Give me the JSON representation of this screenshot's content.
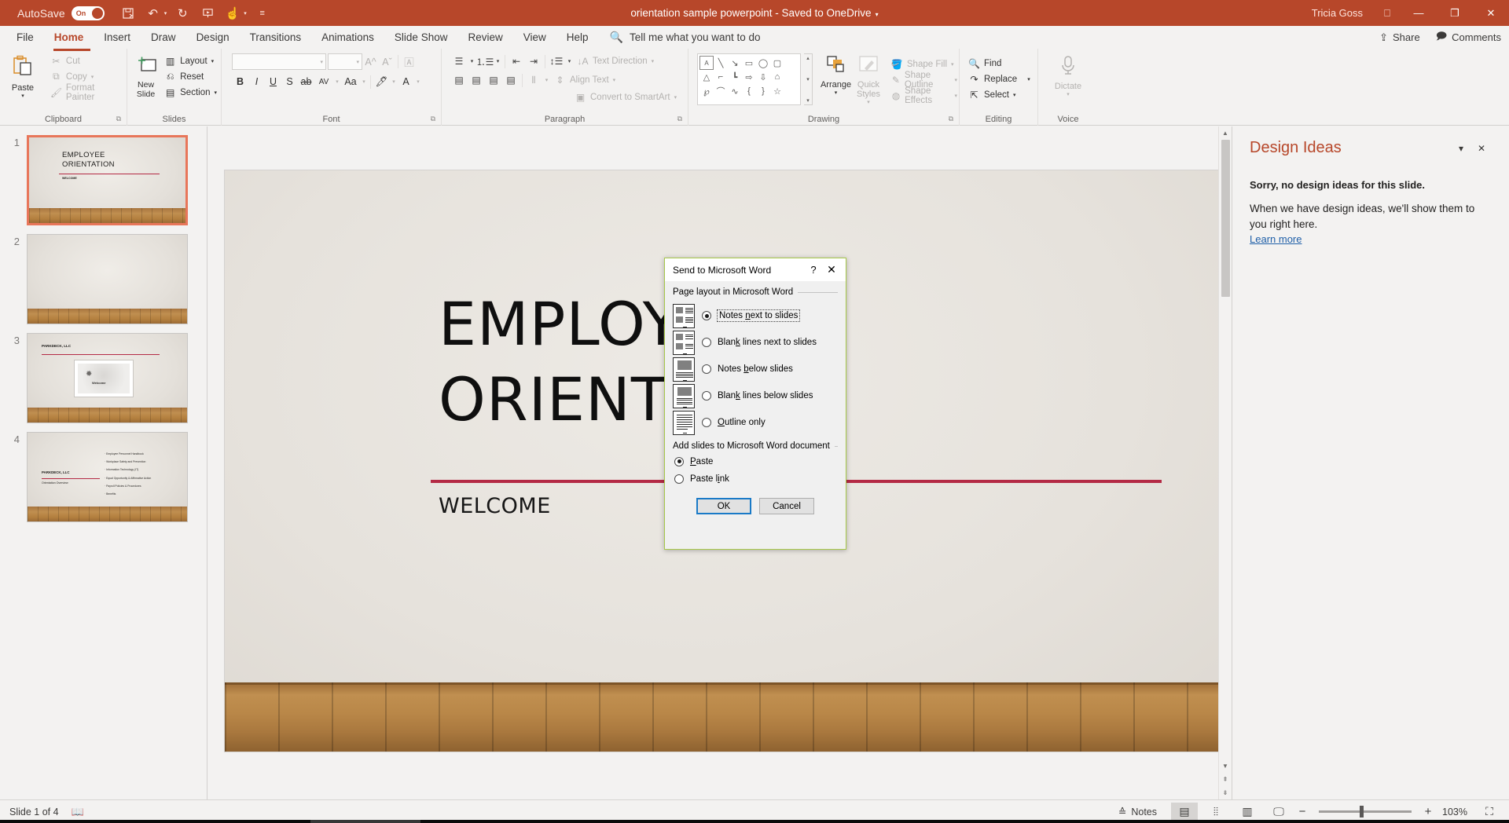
{
  "titlebar": {
    "autosave_label": "AutoSave",
    "autosave_state": "On",
    "document_title": "orientation sample powerpoint  -  Saved to OneDrive",
    "user_name": "Tricia Goss",
    "qat": [
      {
        "name": "save-icon",
        "glyph": "⬚"
      },
      {
        "name": "undo-icon",
        "glyph": "↶"
      },
      {
        "name": "redo-icon",
        "glyph": "↻"
      },
      {
        "name": "start-from-beginning-icon",
        "glyph": "▶"
      },
      {
        "name": "touch-mode-icon",
        "glyph": "☝"
      },
      {
        "name": "customize-qat-icon",
        "glyph": "▾"
      }
    ],
    "window_buttons": [
      {
        "name": "ribbon-display-options",
        "glyph": "⬒"
      },
      {
        "name": "minimize-button",
        "glyph": "—"
      },
      {
        "name": "restore-button",
        "glyph": "❐"
      },
      {
        "name": "close-button",
        "glyph": "✕"
      }
    ]
  },
  "ribbon": {
    "tabs": [
      {
        "label": "File",
        "active": false
      },
      {
        "label": "Home",
        "active": true
      },
      {
        "label": "Insert",
        "active": false
      },
      {
        "label": "Draw",
        "active": false
      },
      {
        "label": "Design",
        "active": false
      },
      {
        "label": "Transitions",
        "active": false
      },
      {
        "label": "Animations",
        "active": false
      },
      {
        "label": "Slide Show",
        "active": false
      },
      {
        "label": "Review",
        "active": false
      },
      {
        "label": "View",
        "active": false
      },
      {
        "label": "Help",
        "active": false
      }
    ],
    "tell_me_placeholder": "Tell me what you want to do",
    "share_label": "Share",
    "comments_label": "Comments",
    "groups": {
      "clipboard": {
        "label": "Clipboard",
        "paste_label": "Paste",
        "items": [
          {
            "label": "Cut",
            "icon": "scissors-icon"
          },
          {
            "label": "Copy",
            "icon": "copy-icon"
          },
          {
            "label": "Format Painter",
            "icon": "format-painter-icon"
          }
        ]
      },
      "slides": {
        "label": "Slides",
        "new_slide_label": "New Slide",
        "items": [
          {
            "label": "Layout",
            "icon": "layout-icon"
          },
          {
            "label": "Reset",
            "icon": "reset-icon"
          },
          {
            "label": "Section",
            "icon": "section-icon"
          }
        ]
      },
      "font": {
        "label": "Font",
        "font_name_value": "",
        "font_size_value": "",
        "buttons": [
          "Bold",
          "Italic",
          "Underline",
          "Text Shadow",
          "Strikethrough",
          "Character Spacing",
          "Change Case",
          "Text Highlight Color",
          "Font Color",
          "Increase Font Size",
          "Decrease Font Size",
          "Clear All Formatting"
        ]
      },
      "paragraph": {
        "label": "Paragraph",
        "text_direction_label": "Text Direction",
        "align_text_label": "Align Text",
        "convert_smartart_label": "Convert to SmartArt"
      },
      "drawing": {
        "label": "Drawing",
        "arrange_label": "Arrange",
        "quick_styles_label": "Quick Styles",
        "shape_fill_label": "Shape Fill",
        "shape_outline_label": "Shape Outline",
        "shape_effects_label": "Shape Effects",
        "shapes": [
          "A",
          "╲",
          "↘",
          "▭",
          "◯",
          "▢",
          "△",
          "⌐",
          "┗",
          "⇨",
          "⇩",
          "⬒",
          "❦",
          "⌒",
          "∿",
          "{",
          "}",
          "☆"
        ]
      },
      "editing": {
        "label": "Editing",
        "find_label": "Find",
        "replace_label": "Replace",
        "select_label": "Select"
      },
      "voice": {
        "label": "Voice",
        "dictate_label": "Dictate"
      }
    }
  },
  "slides": [
    {
      "number": "1",
      "selected": true,
      "title": "EMPLOYEE\nORIENTATION",
      "subtitle": "WELCOME"
    },
    {
      "number": "2",
      "selected": false,
      "title": "",
      "subtitle": ""
    },
    {
      "number": "3",
      "selected": false,
      "title": "PARKDECK, LLC",
      "subtitle": "Welcome"
    },
    {
      "number": "4",
      "selected": false,
      "title": "PARKDECK, LLC",
      "subtitle": "Orientation Overview",
      "bullets": [
        "Employee Personnel Handbook",
        "Workplace Safety and Prevention",
        "Information Technology (IT)",
        "Equal Opportunity & Affirmative Action",
        "Payroll Policies & Procedures",
        "Benefits"
      ]
    }
  ],
  "current_slide": {
    "title_line1": "EMPLOYEE",
    "title_line2": "ORIENTATION",
    "subtitle": "WELCOME"
  },
  "design_ideas": {
    "title": "Design Ideas",
    "message_strong": "Sorry, no design ideas for this slide.",
    "message_body": "When we have design ideas, we'll show them to you right here.",
    "link": "Learn more"
  },
  "status_bar": {
    "slide_indicator": "Slide 1 of 4",
    "accessibility_icon": "accessibility-checker-icon",
    "notes_label": "Notes",
    "views": [
      {
        "name": "normal-view-button",
        "glyph": "▤",
        "active": true
      },
      {
        "name": "slide-sorter-button",
        "glyph": "∷",
        "active": false
      },
      {
        "name": "reading-view-button",
        "glyph": "▥",
        "active": false
      },
      {
        "name": "slide-show-button",
        "glyph": "▷",
        "active": false
      }
    ],
    "zoom_out": "−",
    "zoom_in": "+",
    "zoom_level": "103%",
    "fit_slide_icon": "fit-slide-to-window-icon"
  },
  "dialog": {
    "title": "Send to Microsoft Word",
    "help_glyph": "?",
    "close_glyph": "✕",
    "section1_label": "Page layout in Microsoft Word",
    "layout_options": [
      {
        "label": "Notes next to slides",
        "underline": "n",
        "selected": true,
        "preview": "notes-next-to-slides-preview"
      },
      {
        "label": "Blank lines next to slides",
        "underline": "k",
        "selected": false,
        "preview": "blank-lines-next-to-slides-preview"
      },
      {
        "label": "Notes below slides",
        "underline": "b",
        "selected": false,
        "preview": "notes-below-slides-preview"
      },
      {
        "label": "Blank lines below slides",
        "underline": "k",
        "selected": false,
        "preview": "blank-lines-below-slides-preview"
      },
      {
        "label": "Outline only",
        "underline": "O",
        "selected": false,
        "preview": "outline-only-preview"
      }
    ],
    "section2_label": "Add slides to Microsoft Word document",
    "paste_options": [
      {
        "label": "Paste",
        "selected": true
      },
      {
        "label": "Paste link",
        "selected": false
      }
    ],
    "ok_label": "OK",
    "cancel_label": "Cancel"
  }
}
